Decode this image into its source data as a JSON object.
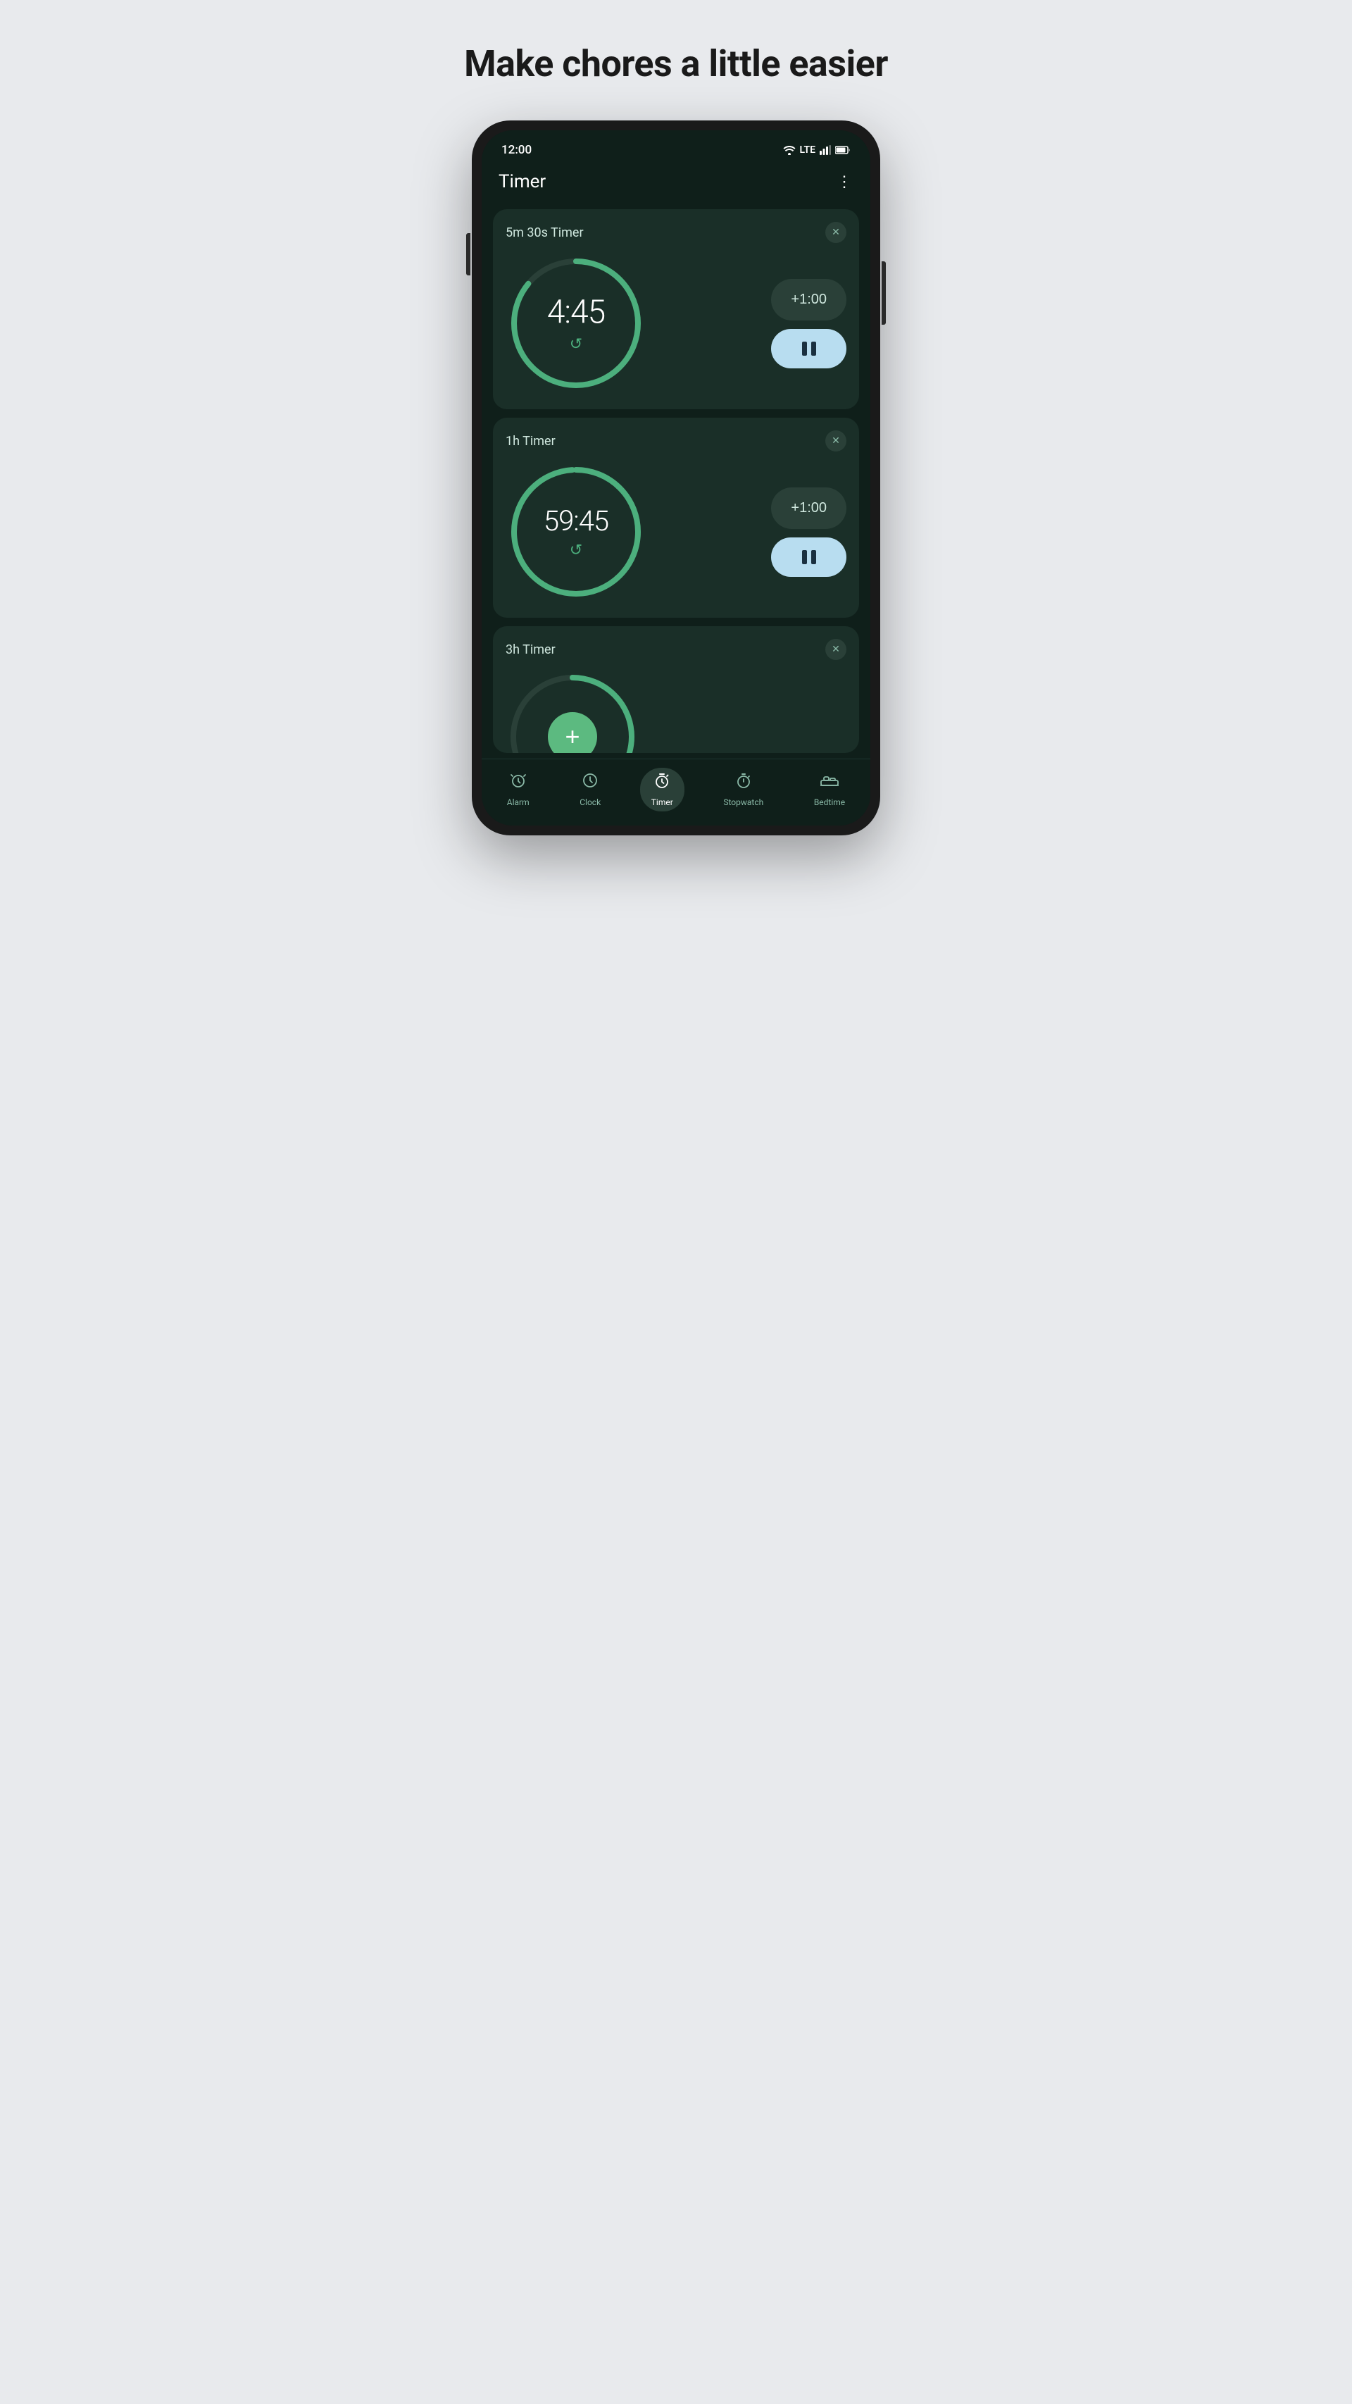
{
  "headline": "Make chores a little easier",
  "status": {
    "time": "12:00",
    "signal": "LTE"
  },
  "app": {
    "title": "Timer"
  },
  "timers": [
    {
      "label": "5m 30s Timer",
      "display": "4:45",
      "progress": 0.86,
      "add_btn": "+1:00",
      "circumference": 565
    },
    {
      "label": "1h Timer",
      "display": "59:45",
      "progress": 0.99,
      "add_btn": "+1:00",
      "circumference": 565
    },
    {
      "label": "3h Timer",
      "display": "",
      "progress": 0.3,
      "add_btn": "+",
      "circumference": 565
    }
  ],
  "nav": {
    "items": [
      {
        "id": "alarm",
        "label": "Alarm",
        "icon": "alarm"
      },
      {
        "id": "clock",
        "label": "Clock",
        "icon": "clock"
      },
      {
        "id": "timer",
        "label": "Timer",
        "icon": "timer",
        "active": true
      },
      {
        "id": "stopwatch",
        "label": "Stopwatch",
        "icon": "stopwatch"
      },
      {
        "id": "bedtime",
        "label": "Bedtime",
        "icon": "bedtime"
      }
    ]
  }
}
